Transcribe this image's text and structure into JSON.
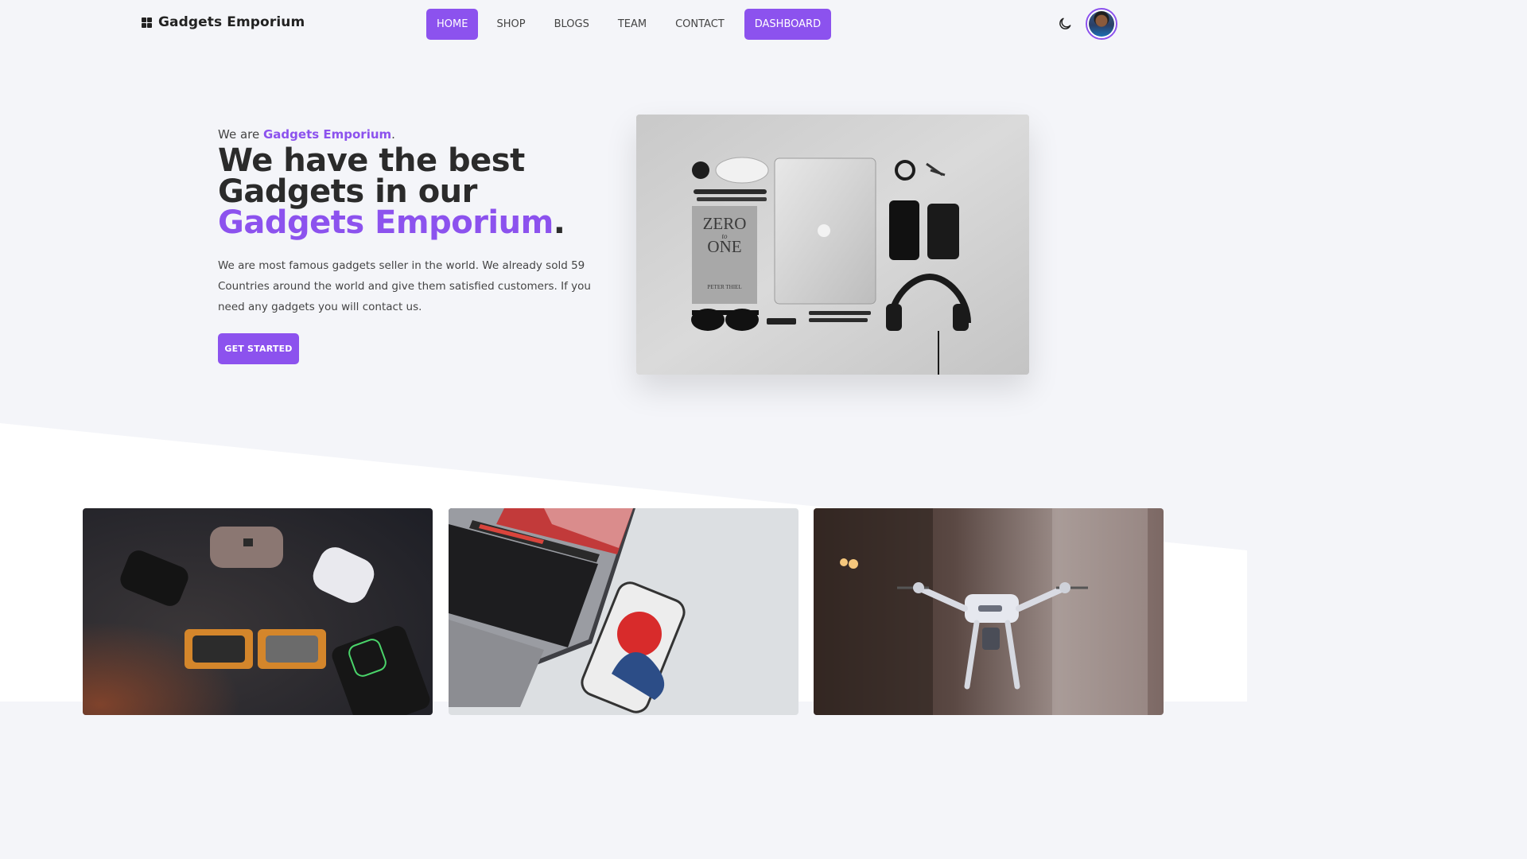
{
  "header": {
    "logo_text": "Gadgets Emporium",
    "nav": [
      {
        "label": "HOME",
        "active": true
      },
      {
        "label": "SHOP"
      },
      {
        "label": "BLOGS"
      },
      {
        "label": "TEAM"
      },
      {
        "label": "CONTACT"
      }
    ],
    "dashboard_label": "DASHBOARD",
    "theme_icon": "moon-icon",
    "avatar_icon": "user-avatar"
  },
  "hero": {
    "intro_prefix": "We are ",
    "intro_brand": "Gadgets Emporium",
    "intro_suffix": ".",
    "title_part1": "We have the best Gadgets in our ",
    "title_accent": "Gadgets Emporium",
    "title_suffix": ".",
    "description": "We are most famous gadgets seller in the world. We already sold 59 Countries around the world and give them satisfied customers. If you need any gadgets you will contact us.",
    "cta_label": "GET STARTED",
    "image_book_line1": "ZERO",
    "image_book_line2": "to",
    "image_book_line3": "ONE",
    "image_book_author": "PETER THIEL"
  },
  "colors": {
    "accent": "#8c52ee",
    "background": "#f4f5f9",
    "text": "#2b2b2b"
  },
  "cards": [
    {
      "name": "earbuds-card"
    },
    {
      "name": "laptop-phone-card"
    },
    {
      "name": "drone-card"
    }
  ]
}
